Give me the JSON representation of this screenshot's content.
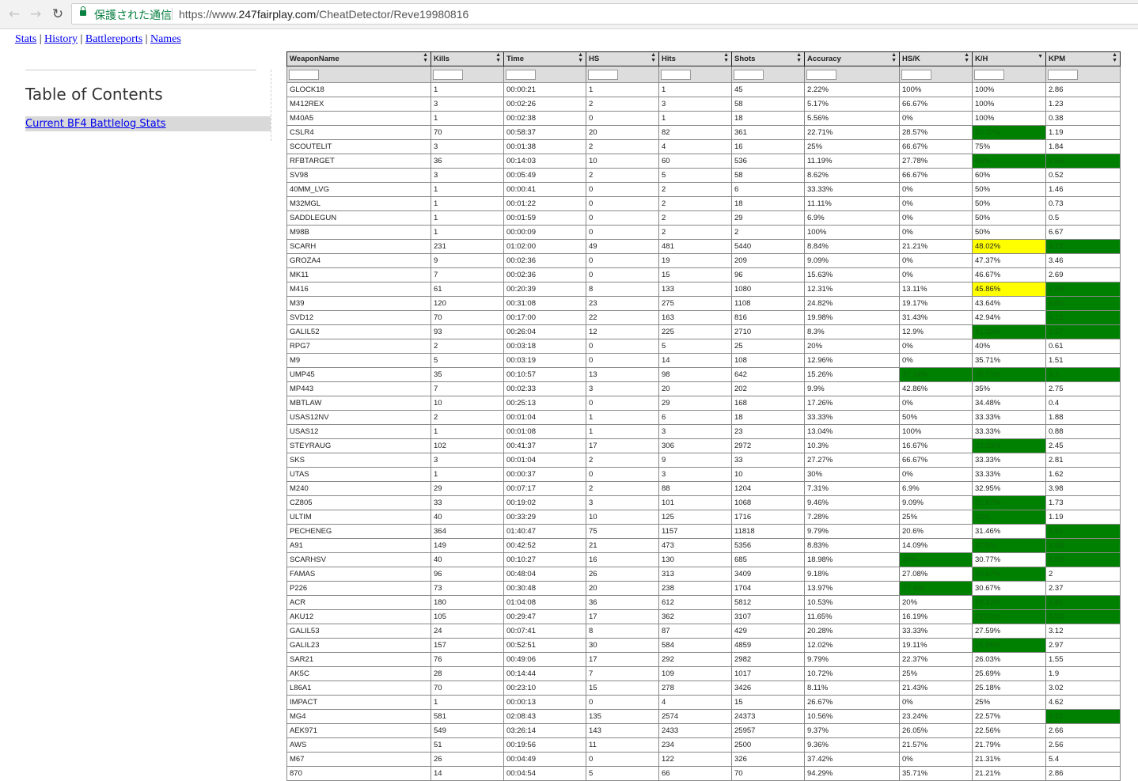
{
  "browser": {
    "secure_label": "保護された通信",
    "url_prefix": "https://www.",
    "url_host": "247fairplay.com",
    "url_path": "/CheatDetector/Reve19980816"
  },
  "nav": {
    "links": [
      "Stats",
      "History",
      "Battlereports",
      "Names"
    ],
    "separator": "|"
  },
  "toc": {
    "title": "Table of Contents",
    "item": "Current BF4 Battlelog Stats"
  },
  "table": {
    "headers": [
      "WeaponName",
      "Kills",
      "Time",
      "HS",
      "Hits",
      "Shots",
      "Accuracy",
      "HS/K",
      "K/H",
      "KPM"
    ],
    "highlight_colors": {
      "green": "#008000",
      "yellow": "#ffff00"
    },
    "rows": [
      {
        "c": [
          "GLOCK18",
          "1",
          "00:00:21",
          "1",
          "1",
          "45",
          "2.22%",
          "100%",
          "100%",
          "2.86"
        ]
      },
      {
        "c": [
          "M412REX",
          "3",
          "00:02:26",
          "2",
          "3",
          "58",
          "5.17%",
          "66.67%",
          "100%",
          "1.23"
        ]
      },
      {
        "c": [
          "M40A5",
          "1",
          "00:02:38",
          "0",
          "1",
          "18",
          "5.56%",
          "0%",
          "100%",
          "0.38"
        ]
      },
      {
        "c": [
          "CSLR4",
          "70",
          "00:58:37",
          "20",
          "82",
          "361",
          "22.71%",
          "28.57%",
          "85.37%",
          "1.19"
        ],
        "h": {
          "8": "g"
        }
      },
      {
        "c": [
          "SCOUTELIT",
          "3",
          "00:01:38",
          "2",
          "4",
          "16",
          "25%",
          "66.67%",
          "75%",
          "1.84"
        ]
      },
      {
        "c": [
          "RFBTARGET",
          "36",
          "00:14:03",
          "10",
          "60",
          "536",
          "11.19%",
          "27.78%",
          "60%",
          "2.56"
        ],
        "h": {
          "8": "g",
          "9": "g"
        }
      },
      {
        "c": [
          "SV98",
          "3",
          "00:05:49",
          "2",
          "5",
          "58",
          "8.62%",
          "66.67%",
          "60%",
          "0.52"
        ]
      },
      {
        "c": [
          "40MM_LVG",
          "1",
          "00:00:41",
          "0",
          "2",
          "6",
          "33.33%",
          "0%",
          "50%",
          "1.46"
        ]
      },
      {
        "c": [
          "M32MGL",
          "1",
          "00:01:22",
          "0",
          "2",
          "18",
          "11.11%",
          "0%",
          "50%",
          "0.73"
        ]
      },
      {
        "c": [
          "SADDLEGUN",
          "1",
          "00:01:59",
          "0",
          "2",
          "29",
          "6.9%",
          "0%",
          "50%",
          "0.5"
        ]
      },
      {
        "c": [
          "M98B",
          "1",
          "00:00:09",
          "0",
          "2",
          "2",
          "100%",
          "0%",
          "50%",
          "6.67"
        ]
      },
      {
        "c": [
          "SCARH",
          "231",
          "01:02:00",
          "49",
          "481",
          "5440",
          "8.84%",
          "21.21%",
          "48.02%",
          "3.73"
        ],
        "h": {
          "8": "y",
          "9": "g"
        }
      },
      {
        "c": [
          "GROZA4",
          "9",
          "00:02:36",
          "0",
          "19",
          "209",
          "9.09%",
          "0%",
          "47.37%",
          "3.46"
        ]
      },
      {
        "c": [
          "MK11",
          "7",
          "00:02:36",
          "0",
          "15",
          "96",
          "15.63%",
          "0%",
          "46.67%",
          "2.69"
        ]
      },
      {
        "c": [
          "M416",
          "61",
          "00:20:39",
          "8",
          "133",
          "1080",
          "12.31%",
          "13.11%",
          "45.86%",
          "2.95"
        ],
        "h": {
          "8": "y",
          "9": "g"
        }
      },
      {
        "c": [
          "M39",
          "120",
          "00:31:08",
          "23",
          "275",
          "1108",
          "24.82%",
          "19.17%",
          "43.64%",
          "3.85"
        ],
        "h": {
          "9": "g"
        }
      },
      {
        "c": [
          "SVD12",
          "70",
          "00:17:00",
          "22",
          "163",
          "816",
          "19.98%",
          "31.43%",
          "42.94%",
          "4.12"
        ],
        "h": {
          "9": "g"
        }
      },
      {
        "c": [
          "GALIL52",
          "93",
          "00:26:04",
          "12",
          "225",
          "2710",
          "8.3%",
          "12.9%",
          "41.33%",
          "3.57"
        ],
        "h": {
          "8": "g",
          "9": "g"
        }
      },
      {
        "c": [
          "RPG7",
          "2",
          "00:03:18",
          "0",
          "5",
          "25",
          "20%",
          "0%",
          "40%",
          "0.61"
        ]
      },
      {
        "c": [
          "M9",
          "5",
          "00:03:19",
          "0",
          "14",
          "108",
          "12.96%",
          "0%",
          "35.71%",
          "1.51"
        ]
      },
      {
        "c": [
          "UMP45",
          "35",
          "00:10:57",
          "13",
          "98",
          "642",
          "15.26%",
          "37.14%",
          "35.71%",
          "3.2"
        ],
        "h": {
          "7": "g",
          "8": "g",
          "9": "g"
        }
      },
      {
        "c": [
          "MP443",
          "7",
          "00:02:33",
          "3",
          "20",
          "202",
          "9.9%",
          "42.86%",
          "35%",
          "2.75"
        ]
      },
      {
        "c": [
          "MBTLAW",
          "10",
          "00:25:13",
          "0",
          "29",
          "168",
          "17.26%",
          "0%",
          "34.48%",
          "0.4"
        ]
      },
      {
        "c": [
          "USAS12NV",
          "2",
          "00:01:04",
          "1",
          "6",
          "18",
          "33.33%",
          "50%",
          "33.33%",
          "1.88"
        ]
      },
      {
        "c": [
          "USAS12",
          "1",
          "00:01:08",
          "1",
          "3",
          "23",
          "13.04%",
          "100%",
          "33.33%",
          "0.88"
        ]
      },
      {
        "c": [
          "STEYRAUG",
          "102",
          "00:41:37",
          "17",
          "306",
          "2972",
          "10.3%",
          "16.67%",
          "33.33%",
          "2.45"
        ],
        "h": {
          "8": "g"
        }
      },
      {
        "c": [
          "SKS",
          "3",
          "00:01:04",
          "2",
          "9",
          "33",
          "27.27%",
          "66.67%",
          "33.33%",
          "2.81"
        ]
      },
      {
        "c": [
          "UTAS",
          "1",
          "00:00:37",
          "0",
          "3",
          "10",
          "30%",
          "0%",
          "33.33%",
          "1.62"
        ]
      },
      {
        "c": [
          "M240",
          "29",
          "00:07:17",
          "2",
          "88",
          "1204",
          "7.31%",
          "6.9%",
          "32.95%",
          "3.98"
        ]
      },
      {
        "c": [
          "CZ805",
          "33",
          "00:19:02",
          "3",
          "101",
          "1068",
          "9.46%",
          "9.09%",
          "32.67%",
          "1.73"
        ],
        "h": {
          "8": "g"
        }
      },
      {
        "c": [
          "ULTIM",
          "40",
          "00:33:29",
          "10",
          "125",
          "1716",
          "7.28%",
          "25%",
          "32%",
          "1.19"
        ],
        "h": {
          "8": "g"
        }
      },
      {
        "c": [
          "PECHENEG",
          "364",
          "01:40:47",
          "75",
          "1157",
          "11818",
          "9.79%",
          "20.6%",
          "31.46%",
          "3.61"
        ],
        "h": {
          "9": "g"
        }
      },
      {
        "c": [
          "A91",
          "149",
          "00:42:52",
          "21",
          "473",
          "5356",
          "8.83%",
          "14.09%",
          "31.5%",
          "3.48"
        ],
        "h": {
          "8": "g",
          "9": "g"
        }
      },
      {
        "c": [
          "SCARHSV",
          "40",
          "00:10:27",
          "16",
          "130",
          "685",
          "18.98%",
          "40%",
          "30.77%",
          "3.83"
        ],
        "h": {
          "7": "g",
          "9": "g"
        }
      },
      {
        "c": [
          "FAMAS",
          "96",
          "00:48:04",
          "26",
          "313",
          "3409",
          "9.18%",
          "27.08%",
          "30.67%",
          "2"
        ],
        "h": {
          "8": "g"
        }
      },
      {
        "c": [
          "P226",
          "73",
          "00:30:48",
          "20",
          "238",
          "1704",
          "13.97%",
          "27.4%",
          "30.67%",
          "2.37"
        ],
        "h": {
          "7": "g"
        }
      },
      {
        "c": [
          "ACR",
          "180",
          "01:04:08",
          "36",
          "612",
          "5812",
          "10.53%",
          "20%",
          "29.41%",
          "2.81"
        ],
        "h": {
          "8": "g",
          "9": "g"
        }
      },
      {
        "c": [
          "AKU12",
          "105",
          "00:29:47",
          "17",
          "362",
          "3107",
          "11.65%",
          "16.19%",
          "29.01%",
          "3.53"
        ],
        "h": {
          "8": "g",
          "9": "g"
        }
      },
      {
        "c": [
          "GALIL53",
          "24",
          "00:07:41",
          "8",
          "87",
          "429",
          "20.28%",
          "33.33%",
          "27.59%",
          "3.12"
        ]
      },
      {
        "c": [
          "GALIL23",
          "157",
          "00:52:51",
          "30",
          "584",
          "4859",
          "12.02%",
          "19.11%",
          "26.88%",
          "2.97"
        ],
        "h": {
          "8": "g"
        }
      },
      {
        "c": [
          "SAR21",
          "76",
          "00:49:06",
          "17",
          "292",
          "2982",
          "9.79%",
          "22.37%",
          "26.03%",
          "1.55"
        ]
      },
      {
        "c": [
          "AK5C",
          "28",
          "00:14:44",
          "7",
          "109",
          "1017",
          "10.72%",
          "25%",
          "25.69%",
          "1.9"
        ]
      },
      {
        "c": [
          "L86A1",
          "70",
          "00:23:10",
          "15",
          "278",
          "3426",
          "8.11%",
          "21.43%",
          "25.18%",
          "3.02"
        ]
      },
      {
        "c": [
          "IMPACT",
          "1",
          "00:00:13",
          "0",
          "4",
          "15",
          "26.67%",
          "0%",
          "25%",
          "4.62"
        ]
      },
      {
        "c": [
          "MG4",
          "581",
          "02:08:43",
          "135",
          "2574",
          "24373",
          "10.56%",
          "23.24%",
          "22.57%",
          "4.51"
        ],
        "h": {
          "9": "g"
        }
      },
      {
        "c": [
          "AEK971",
          "549",
          "03:26:14",
          "143",
          "2433",
          "25957",
          "9.37%",
          "26.05%",
          "22.56%",
          "2.66"
        ]
      },
      {
        "c": [
          "AWS",
          "51",
          "00:19:56",
          "11",
          "234",
          "2500",
          "9.36%",
          "21.57%",
          "21.79%",
          "2.56"
        ]
      },
      {
        "c": [
          "M67",
          "26",
          "00:04:49",
          "0",
          "122",
          "326",
          "37.42%",
          "0%",
          "21.31%",
          "5.4"
        ]
      },
      {
        "c": [
          "870",
          "14",
          "00:04:54",
          "5",
          "66",
          "70",
          "94.29%",
          "35.71%",
          "21.21%",
          "2.86"
        ]
      }
    ]
  }
}
